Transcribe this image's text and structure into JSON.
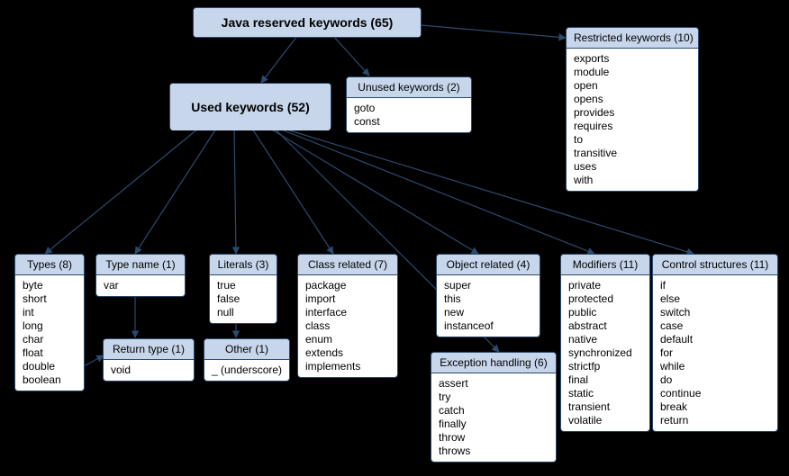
{
  "root": {
    "title": "Java reserved keywords (65)"
  },
  "used": {
    "title": "Used keywords (52)"
  },
  "unused": {
    "title": "Unused keywords (2)",
    "items": [
      "goto",
      "const"
    ]
  },
  "restricted": {
    "title": "Restricted keywords (10)",
    "items": [
      "exports",
      "module",
      "open",
      "opens",
      "provides",
      "requires",
      "to",
      "transitive",
      "uses",
      "with"
    ]
  },
  "types": {
    "title": "Types (8)",
    "items": [
      "byte",
      "short",
      "int",
      "long",
      "char",
      "float",
      "double",
      "boolean"
    ]
  },
  "typename": {
    "title": "Type name (1)",
    "items": [
      "var"
    ]
  },
  "returntype": {
    "title": "Return type (1)",
    "items": [
      "void"
    ]
  },
  "literals": {
    "title": "Literals (3)",
    "items": [
      "true",
      "false",
      "null"
    ]
  },
  "other": {
    "title": "Other (1)",
    "items": [
      "_ (underscore)"
    ]
  },
  "classrel": {
    "title": "Class related (7)",
    "items": [
      "package",
      "import",
      "interface",
      "class",
      "enum",
      "extends",
      "implements"
    ]
  },
  "objrel": {
    "title": "Object related (4)",
    "items": [
      "super",
      "this",
      "new",
      "instanceof"
    ]
  },
  "exchand": {
    "title": "Exception handling (6)",
    "items": [
      "assert",
      "try",
      "catch",
      "finally",
      "throw",
      "throws"
    ]
  },
  "modifiers": {
    "title": "Modifiers (11)",
    "items": [
      "private",
      "protected",
      "public",
      "abstract",
      "native",
      "synchronized",
      "strictfp",
      "final",
      "static",
      "transient",
      "volatile"
    ]
  },
  "control": {
    "title": "Control structures (11)",
    "items": [
      "if",
      "else",
      "switch",
      "case",
      "default",
      "for",
      "while",
      "do",
      "continue",
      "break",
      "return"
    ]
  }
}
